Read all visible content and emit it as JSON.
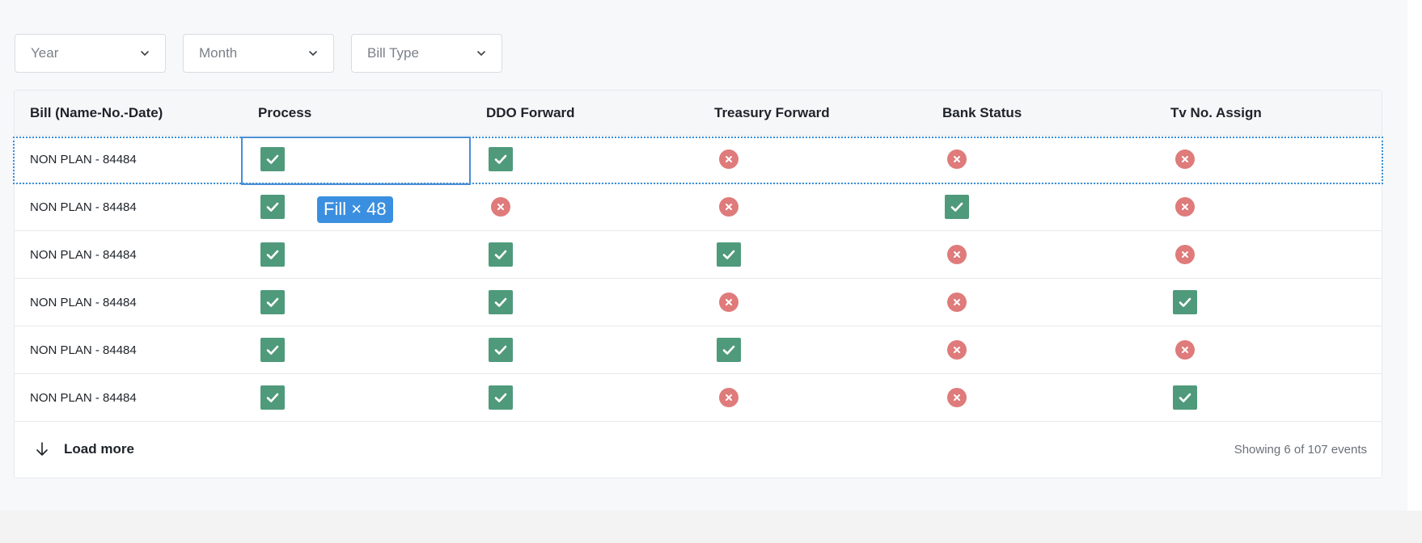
{
  "filters": {
    "year": {
      "placeholder": "Year",
      "icon": "chevron-down-icon"
    },
    "month": {
      "placeholder": "Month",
      "icon": "chevron-down-icon"
    },
    "bill_type": {
      "placeholder": "Bill Type",
      "icon": "chevron-down-icon"
    }
  },
  "table": {
    "columns": [
      "Bill (Name-No.-Date)",
      "Process",
      "DDO Forward",
      "Treasury Forward",
      "Bank Status",
      "Tv No. Assign"
    ],
    "rows": [
      {
        "bill": "NON PLAN - 84484",
        "status": [
          true,
          true,
          false,
          false,
          false
        ]
      },
      {
        "bill": "NON PLAN - 84484",
        "status": [
          true,
          false,
          false,
          true,
          false
        ]
      },
      {
        "bill": "NON PLAN - 84484",
        "status": [
          true,
          true,
          true,
          false,
          false
        ]
      },
      {
        "bill": "NON PLAN - 84484",
        "status": [
          true,
          true,
          false,
          false,
          true
        ]
      },
      {
        "bill": "NON PLAN - 84484",
        "status": [
          true,
          true,
          true,
          false,
          false
        ]
      },
      {
        "bill": "NON PLAN - 84484",
        "status": [
          true,
          true,
          false,
          false,
          true
        ]
      }
    ]
  },
  "selection": {
    "fill_label": "Fill × 48"
  },
  "footer": {
    "load_more_label": "Load more",
    "load_more_icon": "arrow-down-icon",
    "showing_text": "Showing 6 of 107 events"
  },
  "colors": {
    "check": "#4f9a7b",
    "cross": "#df7b7b",
    "selection": "#3a8fd9"
  }
}
